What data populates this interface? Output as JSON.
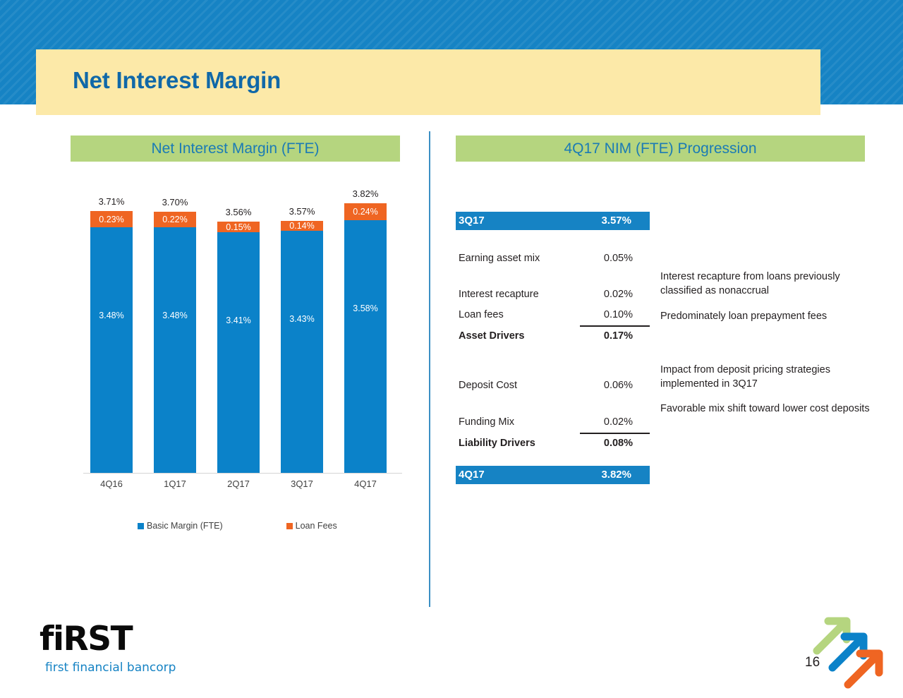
{
  "page_title": "Net Interest Margin",
  "page_number": "16",
  "sections": {
    "left_header": "Net Interest Margin (FTE)",
    "right_header": "4Q17 NIM (FTE) Progression"
  },
  "colors": {
    "banner_blue": "#1683c4",
    "title_band_yellow": "#fce9a8",
    "section_green": "#b5d57f",
    "basic_margin_blue": "#0b82c9",
    "loan_fees_orange": "#ef6522",
    "title_text_blue": "#1068a8",
    "divider_blue": "#3b8fc4"
  },
  "chart_data": {
    "type": "bar",
    "subtype": "stacked",
    "title": "Net Interest Margin (FTE)",
    "xlabel": "",
    "ylabel": "",
    "ylim": [
      0,
      4.0
    ],
    "grid": false,
    "legend_position": "bottom",
    "categories": [
      "4Q16",
      "1Q17",
      "2Q17",
      "3Q17",
      "4Q17"
    ],
    "series": [
      {
        "name": "Basic Margin (FTE)",
        "color": "#0b82c9",
        "values": [
          3.48,
          3.48,
          3.41,
          3.43,
          3.58
        ],
        "labels": [
          "3.48%",
          "3.48%",
          "3.41%",
          "3.43%",
          "3.58%"
        ]
      },
      {
        "name": "Loan Fees",
        "color": "#ef6522",
        "values": [
          0.23,
          0.22,
          0.15,
          0.14,
          0.24
        ],
        "labels": [
          "0.23%",
          "0.22%",
          "0.15%",
          "0.14%",
          "0.24%"
        ]
      }
    ],
    "totals": [
      3.71,
      3.7,
      3.56,
      3.57,
      3.82
    ],
    "total_labels": [
      "3.71%",
      "3.70%",
      "3.56%",
      "3.57%",
      "3.82%"
    ]
  },
  "progression": {
    "start_band": {
      "label": "3Q17",
      "value": "3.57%"
    },
    "end_band": {
      "label": "4Q17",
      "value": "3.82%"
    },
    "asset_rows": [
      {
        "label": "Earning asset mix",
        "value": "0.05%",
        "note": ""
      },
      {
        "label": "Interest recapture",
        "value": "0.02%",
        "note": "Interest recapture from loans previously classified as nonaccrual"
      },
      {
        "label": "Loan fees",
        "value": "0.10%",
        "note": "Predominately loan prepayment fees"
      }
    ],
    "asset_total": {
      "label": "Asset Drivers",
      "value": "0.17%"
    },
    "liability_rows": [
      {
        "label": "Deposit Cost",
        "value": "0.06%",
        "note": "Impact from deposit pricing strategies implemented in 3Q17"
      },
      {
        "label": "Funding Mix",
        "value": "0.02%",
        "note": "Favorable mix shift toward lower cost deposits"
      }
    ],
    "liability_total": {
      "label": "Liability Drivers",
      "value": "0.08%"
    }
  },
  "footer": {
    "wordmark": "fiRST",
    "tagline": "first financial bancorp"
  }
}
